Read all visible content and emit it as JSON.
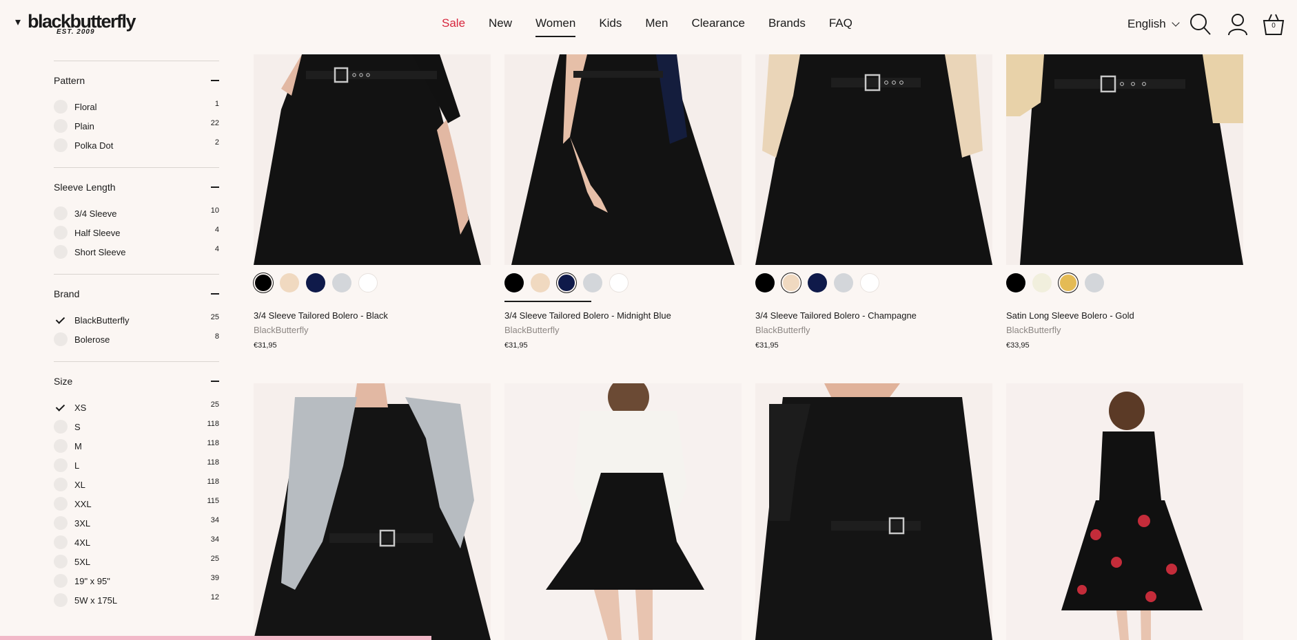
{
  "header": {
    "logo_text": "blackbutterfly",
    "logo_est": "EST. 2009",
    "nav": [
      {
        "label": "Sale",
        "id": "sale"
      },
      {
        "label": "New",
        "id": "new"
      },
      {
        "label": "Women",
        "id": "women"
      },
      {
        "label": "Kids",
        "id": "kids"
      },
      {
        "label": "Men",
        "id": "men"
      },
      {
        "label": "Clearance",
        "id": "clearance"
      },
      {
        "label": "Brands",
        "id": "brands"
      },
      {
        "label": "FAQ",
        "id": "faq"
      }
    ],
    "language": "English",
    "cart_count": "0",
    "icons": {
      "search": "search-icon",
      "account": "account-icon",
      "cart": "basket-icon"
    }
  },
  "filters": [
    {
      "title": "Pattern",
      "options": [
        {
          "label": "Floral",
          "count": "1",
          "checked": false
        },
        {
          "label": "Plain",
          "count": "22",
          "checked": false
        },
        {
          "label": "Polka Dot",
          "count": "2",
          "checked": false
        }
      ]
    },
    {
      "title": "Sleeve Length",
      "options": [
        {
          "label": "3/4 Sleeve",
          "count": "10",
          "checked": false
        },
        {
          "label": "Half Sleeve",
          "count": "4",
          "checked": false
        },
        {
          "label": "Short Sleeve",
          "count": "4",
          "checked": false
        }
      ]
    },
    {
      "title": "Brand",
      "options": [
        {
          "label": "BlackButterfly",
          "count": "25",
          "checked": true
        },
        {
          "label": "Bolerose",
          "count": "8",
          "checked": false
        }
      ]
    },
    {
      "title": "Size",
      "options": [
        {
          "label": "XS",
          "count": "25",
          "checked": true
        },
        {
          "label": "S",
          "count": "118",
          "checked": false
        },
        {
          "label": "M",
          "count": "118",
          "checked": false
        },
        {
          "label": "L",
          "count": "118",
          "checked": false
        },
        {
          "label": "XL",
          "count": "118",
          "checked": false
        },
        {
          "label": "XXL",
          "count": "115",
          "checked": false
        },
        {
          "label": "3XL",
          "count": "34",
          "checked": false
        },
        {
          "label": "4XL",
          "count": "34",
          "checked": false
        },
        {
          "label": "5XL",
          "count": "25",
          "checked": false
        },
        {
          "label": "19\" x 95\"",
          "count": "39",
          "checked": false
        },
        {
          "label": "5W x 175L",
          "count": "12",
          "checked": false
        }
      ]
    }
  ],
  "products": [
    {
      "name": "3/4 Sleeve Tailored Bolero - Black",
      "brand": "BlackButterfly",
      "price": "€31,95",
      "sleeve_color": "#111111",
      "swatches": [
        "#000000",
        "#f0d9c0",
        "#0f1a4a",
        "#d3d6da",
        "#ffffff"
      ],
      "selected_swatch": 0
    },
    {
      "name": "3/4 Sleeve Tailored Bolero - Midnight Blue",
      "brand": "BlackButterfly",
      "price": "€31,95",
      "sleeve_color": "#141d3d",
      "swatches": [
        "#000000",
        "#f0d9c0",
        "#0f1a4a",
        "#d3d6da",
        "#ffffff"
      ],
      "selected_swatch": 2
    },
    {
      "name": "3/4 Sleeve Tailored Bolero - Champagne",
      "brand": "BlackButterfly",
      "price": "€31,95",
      "sleeve_color": "#ead5b8",
      "swatches": [
        "#000000",
        "#f0d9c0",
        "#0f1a4a",
        "#d3d6da",
        "#ffffff"
      ],
      "selected_swatch": 1
    },
    {
      "name": "Satin Long Sleeve Bolero - Gold",
      "brand": "BlackButterfly",
      "price": "€33,95",
      "sleeve_color": "#e8d2a9",
      "swatches": [
        "#000000",
        "#f1efdd",
        "#e4bb55",
        "#d3d6da"
      ],
      "selected_swatch": 2
    }
  ],
  "row2_products": [
    {
      "id": "grey-bolero"
    },
    {
      "id": "white-sheer-bolero"
    },
    {
      "id": "black-bolero"
    },
    {
      "id": "floral-dress"
    }
  ]
}
